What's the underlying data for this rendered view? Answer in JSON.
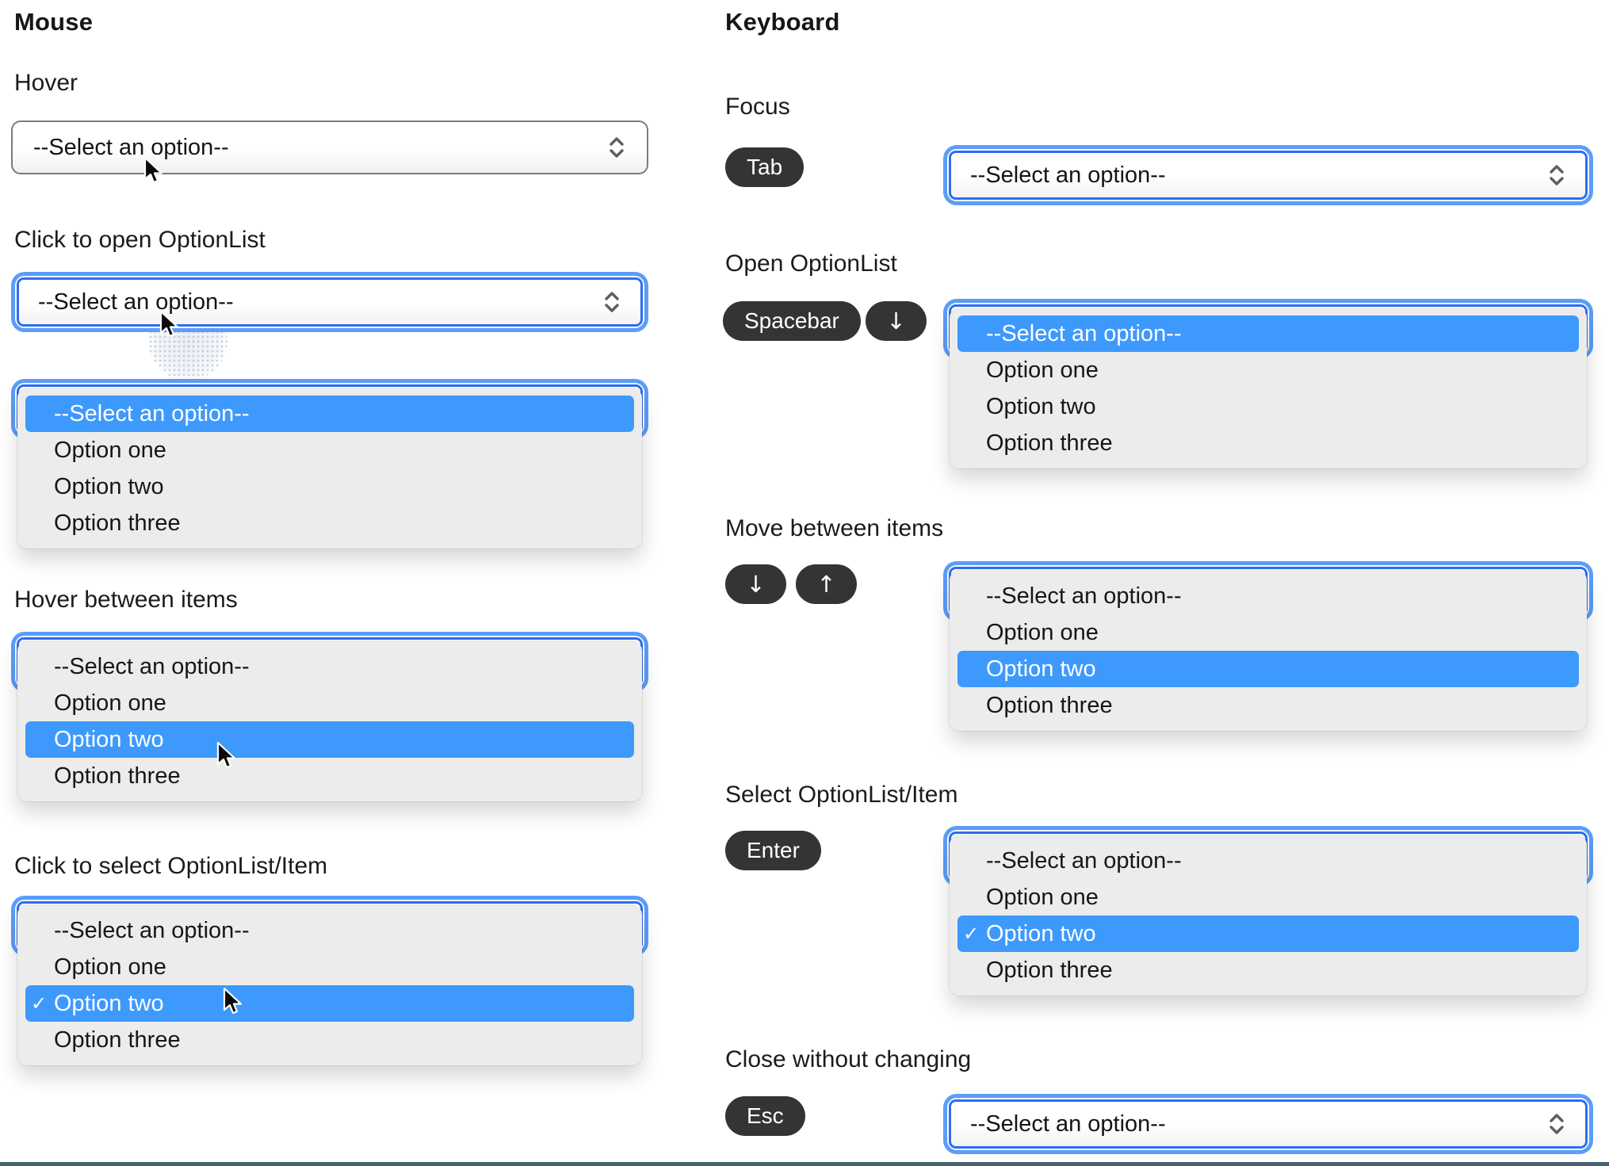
{
  "colors": {
    "highlight_blue": "#3E99FC",
    "focus_ring_blue": "#5B9DF9",
    "focus_border_blue": "#2C6EF2",
    "key_badge_bg": "#343437",
    "bottom_divider": "#45606E"
  },
  "options": {
    "placeholder": "--Select an option--",
    "items": [
      "--Select an option--",
      "Option one",
      "Option two",
      "Option three"
    ],
    "checkmark": "✓"
  },
  "mouse": {
    "title": "Mouse",
    "hover_label": "Hover",
    "click_open_label": "Click to open OptionList",
    "hover_items_label": "Hover between items",
    "click_select_label": "Click to select OptionList/Item"
  },
  "keyboard": {
    "title": "Keyboard",
    "focus_label": "Focus",
    "open_label": "Open OptionList",
    "move_label": "Move between items",
    "select_label": "Select OptionList/Item",
    "close_label": "Close without changing",
    "keys": {
      "tab": "Tab",
      "spacebar": "Spacebar",
      "arrow_down": "↓",
      "arrow_up": "↑",
      "enter": "Enter",
      "esc": "Esc"
    }
  }
}
